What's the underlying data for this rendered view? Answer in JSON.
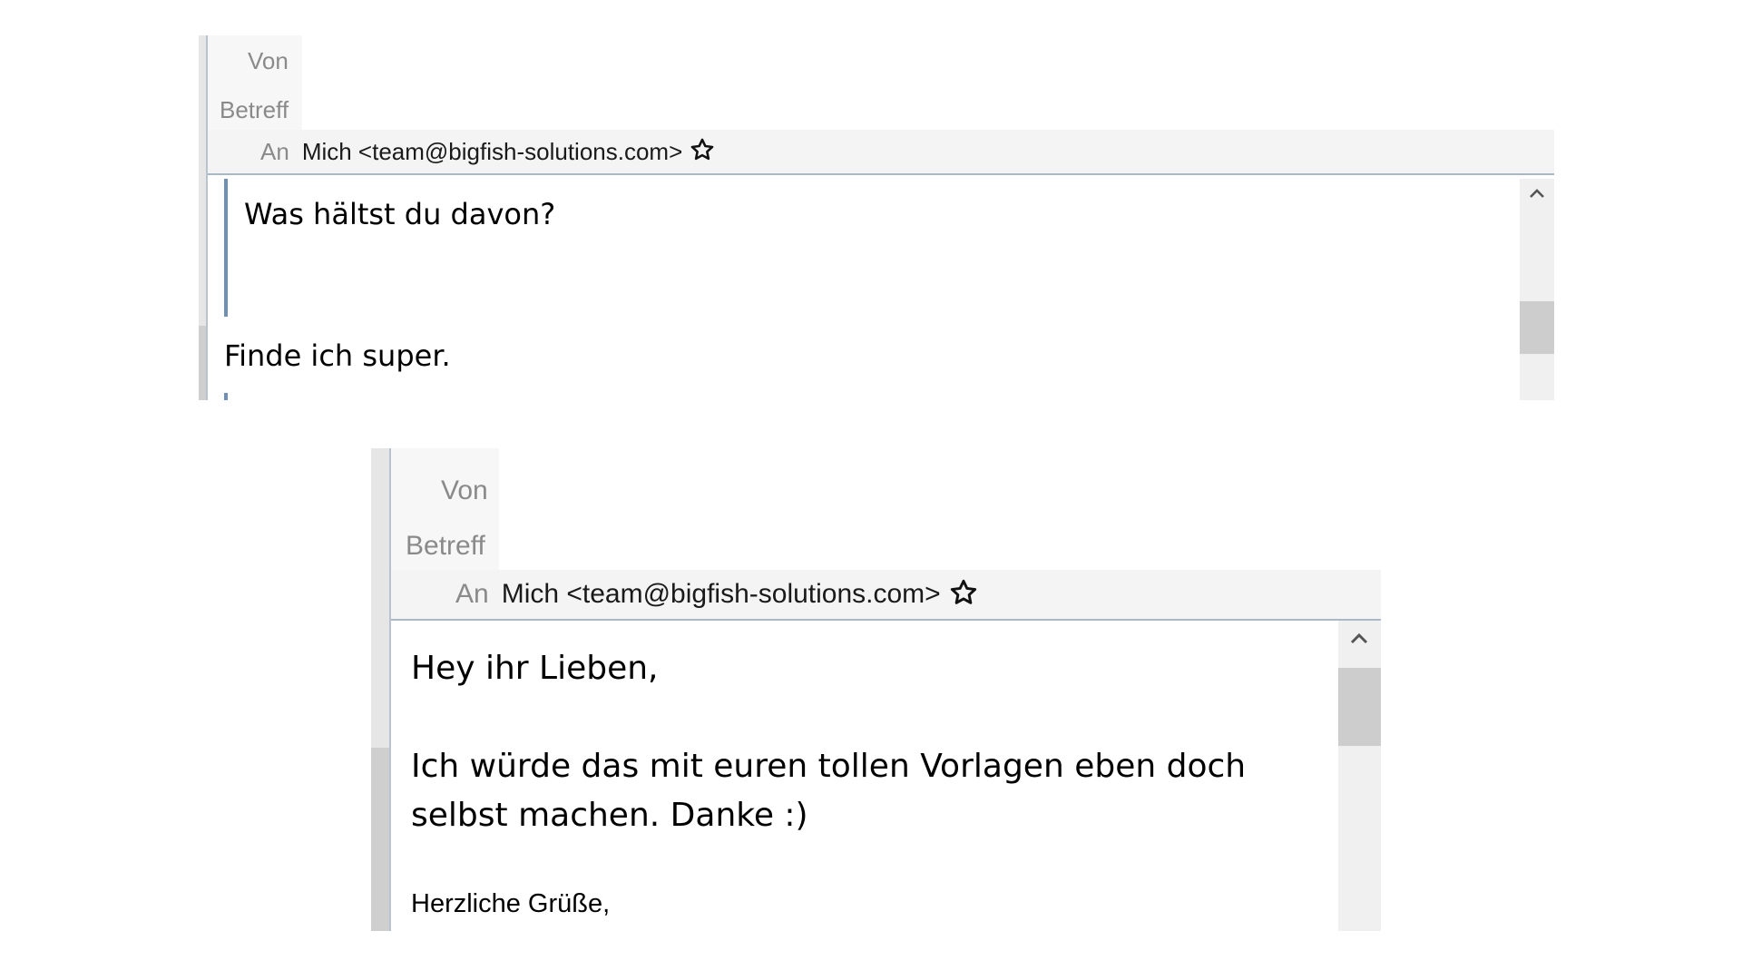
{
  "email_top": {
    "from_label": "Von",
    "subject_label": "Betreff",
    "to_label": "An",
    "to_value": "Mich <team@bigfish-solutions.com>",
    "quoted_text": "Was hältst du davon?",
    "reply_text": "Finde ich super."
  },
  "email_bottom": {
    "from_label": "Von",
    "subject_label": "Betreff",
    "to_label": "An",
    "to_value": "Mich <team@bigfish-solutions.com>",
    "greeting": "Hey ihr Lieben,",
    "body_line1": "Ich würde das mit euren tollen Vorlagen eben doch",
    "body_line2": "selbst machen. Danke :)",
    "closing": "Herzliche Grüße,"
  },
  "icons": {
    "star": "star-icon",
    "scroll_up": "chevron-up-icon"
  }
}
